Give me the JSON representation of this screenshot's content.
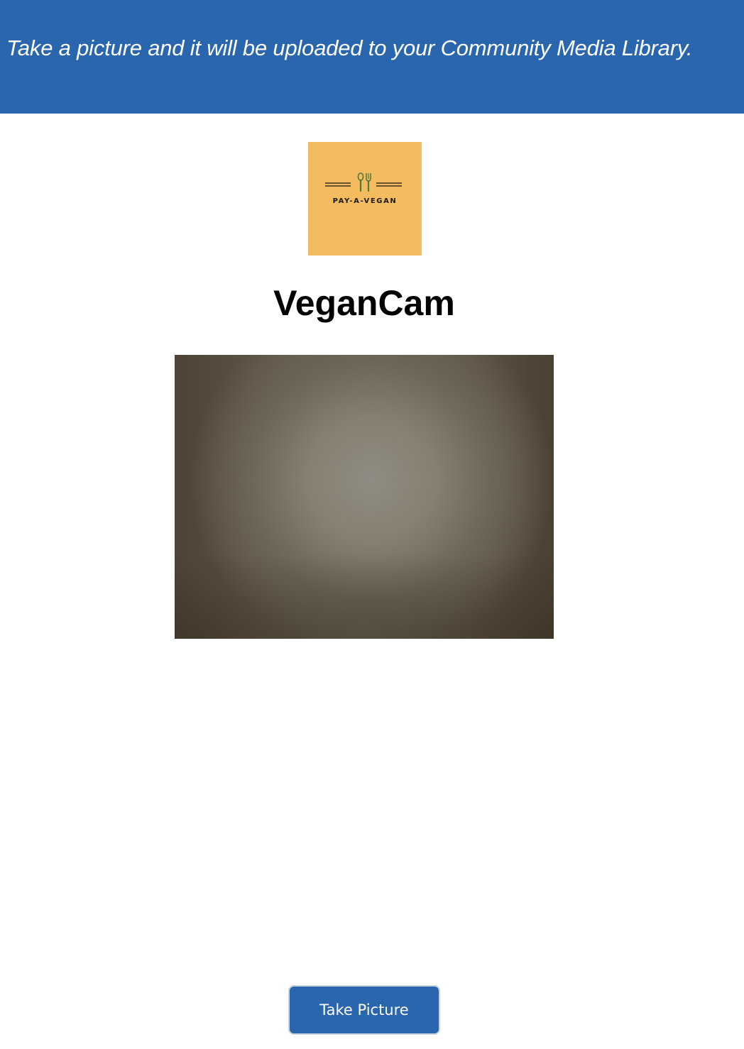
{
  "banner": {
    "text": "Take a picture and it will be uploaded to your Community Media Library.",
    "background_color": "#2966ad"
  },
  "logo": {
    "text": "PAY-A-VEGAN",
    "background_color": "#f5bc5f",
    "icon": "fork-spoon-icon"
  },
  "title": "VeganCam",
  "camera": {
    "icon": "camera-preview"
  },
  "button": {
    "label": "Take Picture",
    "color": "#2966ad"
  }
}
